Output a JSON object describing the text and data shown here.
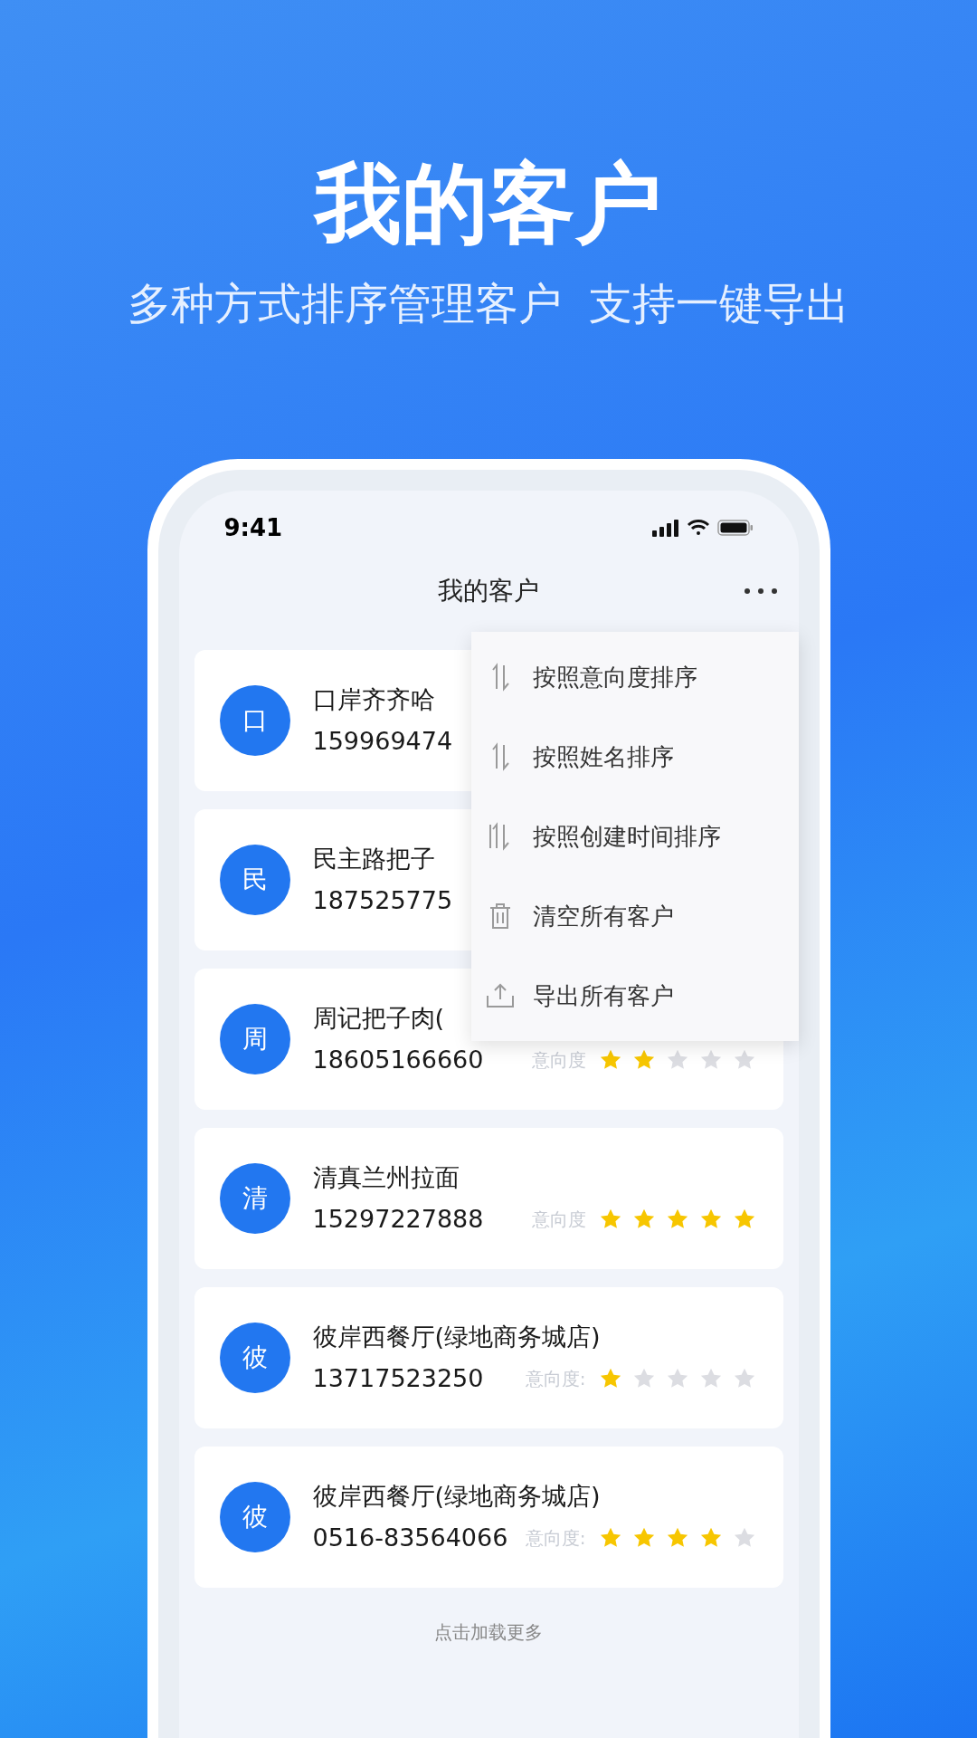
{
  "headline": "我的客户",
  "subtitle": "多种方式排序管理客户  支持一键导出",
  "status_bar": {
    "time": "9:41"
  },
  "header": {
    "title": "我的客户"
  },
  "customers": [
    {
      "avatar": "口",
      "name": "口岸齐齐哈",
      "phone": "159969474"
    },
    {
      "avatar": "民",
      "name": "民主路把子",
      "phone": "187525775"
    },
    {
      "avatar": "周",
      "name": "周记把子肉(",
      "phone": "18605166660",
      "rating_label": "意向度",
      "stars": 2
    },
    {
      "avatar": "清",
      "name": "清真兰州拉面",
      "phone": "15297227888",
      "rating_label": "意向度",
      "stars": 5
    },
    {
      "avatar": "彼",
      "name": "彼岸西餐厅(绿地商务城店)",
      "phone": "13717523250",
      "rating_label": "意向度:",
      "stars": 1
    },
    {
      "avatar": "彼",
      "name": "彼岸西餐厅(绿地商务城店)",
      "phone": "0516-83564066",
      "rating_label": "意向度:",
      "stars": 4
    }
  ],
  "menu": [
    {
      "kind": "sort",
      "label": "按照意向度排序"
    },
    {
      "kind": "sort",
      "label": "按照姓名排序"
    },
    {
      "kind": "sort-time",
      "label": "按照创建时间排序"
    },
    {
      "kind": "clear",
      "label": "清空所有客户"
    },
    {
      "kind": "export",
      "label": "导出所有客户"
    }
  ],
  "load_more": "点击加载更多"
}
